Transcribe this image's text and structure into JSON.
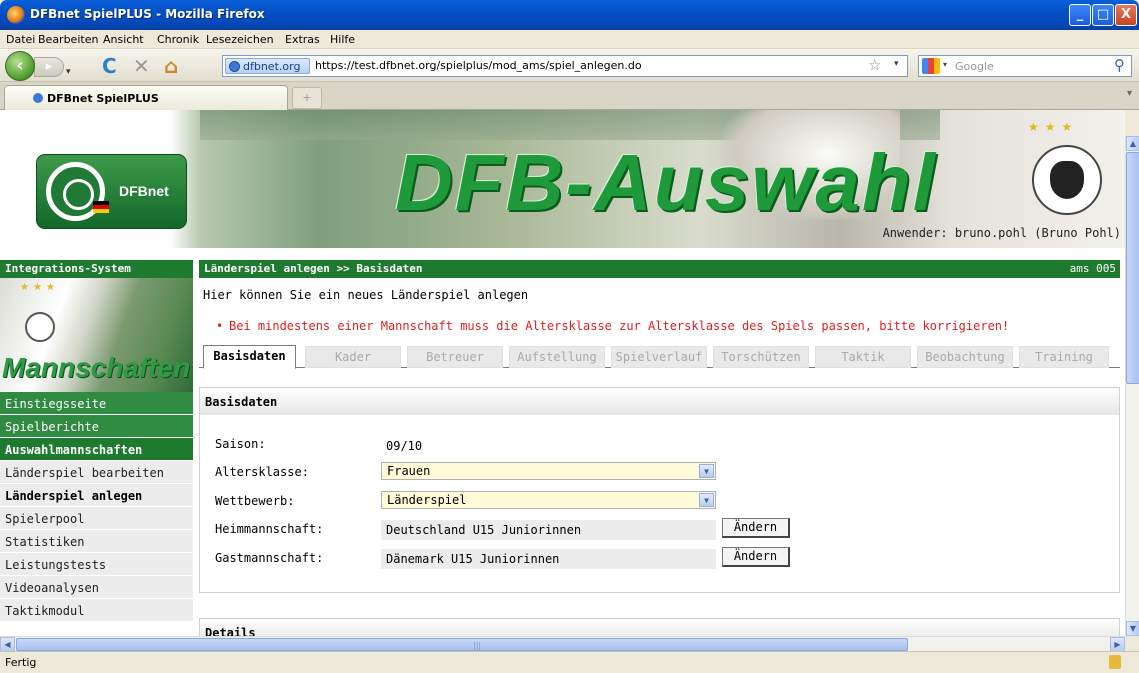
{
  "window": {
    "title": "DFBnet SpielPLUS - Mozilla Firefox",
    "buttons": {
      "minimize": "_",
      "maximize": "□",
      "close": "X"
    }
  },
  "menu": [
    "Datei",
    "Bearbeiten",
    "Ansicht",
    "Chronik",
    "Lesezeichen",
    "Extras",
    "Hilfe"
  ],
  "nav": {
    "site_label": "dfbnet.org",
    "url": "https://test.dfbnet.org/spielplus/mod_ams/spiel_anlegen.do",
    "search_placeholder": "Google"
  },
  "tab": {
    "title": "DFBnet SpielPLUS",
    "new_tab": "+"
  },
  "banner": {
    "logo_text": "DFBnet",
    "title": "DFB-Auswahl",
    "user": "Anwender: bruno.pohl (Bruno Pohl)"
  },
  "sidebar": {
    "header": "Integrations-System",
    "image_title": "Mannschaften",
    "items": [
      {
        "label": "Einstiegsseite",
        "style": "green"
      },
      {
        "label": "Spielberichte",
        "style": "green"
      },
      {
        "label": "Auswahlmannschaften",
        "style": "greenbold"
      },
      {
        "label": "Länderspiel bearbeiten",
        "style": "grey"
      },
      {
        "label": "Länderspiel anlegen",
        "style": "active"
      },
      {
        "label": "Spielerpool",
        "style": "grey"
      },
      {
        "label": "Statistiken",
        "style": "grey"
      },
      {
        "label": "Leistungstests",
        "style": "grey"
      },
      {
        "label": "Videoanalysen",
        "style": "grey"
      },
      {
        "label": "Taktikmodul",
        "style": "grey"
      }
    ]
  },
  "main": {
    "header": "Länderspiel anlegen >> Basisdaten",
    "code": "ams 005",
    "intro": "Hier können Sie ein neues Länderspiel anlegen",
    "error": "Bei mindestens einer Mannschaft muss die Altersklasse zur Altersklasse des Spiels passen, bitte korrigieren!",
    "tabs": [
      "Basisdaten",
      "Kader",
      "Betreuer",
      "Aufstellung",
      "Spielverlauf",
      "Torschützen",
      "Taktik",
      "Beobachtung",
      "Training"
    ],
    "active_tab": "Basisdaten",
    "section_title": "Basisdaten",
    "fields": {
      "saison_label": "Saison:",
      "saison_value": "09/10",
      "altersklasse_label": "Altersklasse:",
      "altersklasse_value": "Frauen",
      "wettbewerb_label": "Wettbewerb:",
      "wettbewerb_value": "Länderspiel",
      "heim_label": "Heimmannschaft:",
      "heim_value": "Deutschland U15 Juniorinnen",
      "gast_label": "Gastmannschaft:",
      "gast_value": "Dänemark U15 Juniorinnen",
      "change_label": "Ändern"
    },
    "section2_title": "Details"
  },
  "status": {
    "text": "Fertig"
  }
}
